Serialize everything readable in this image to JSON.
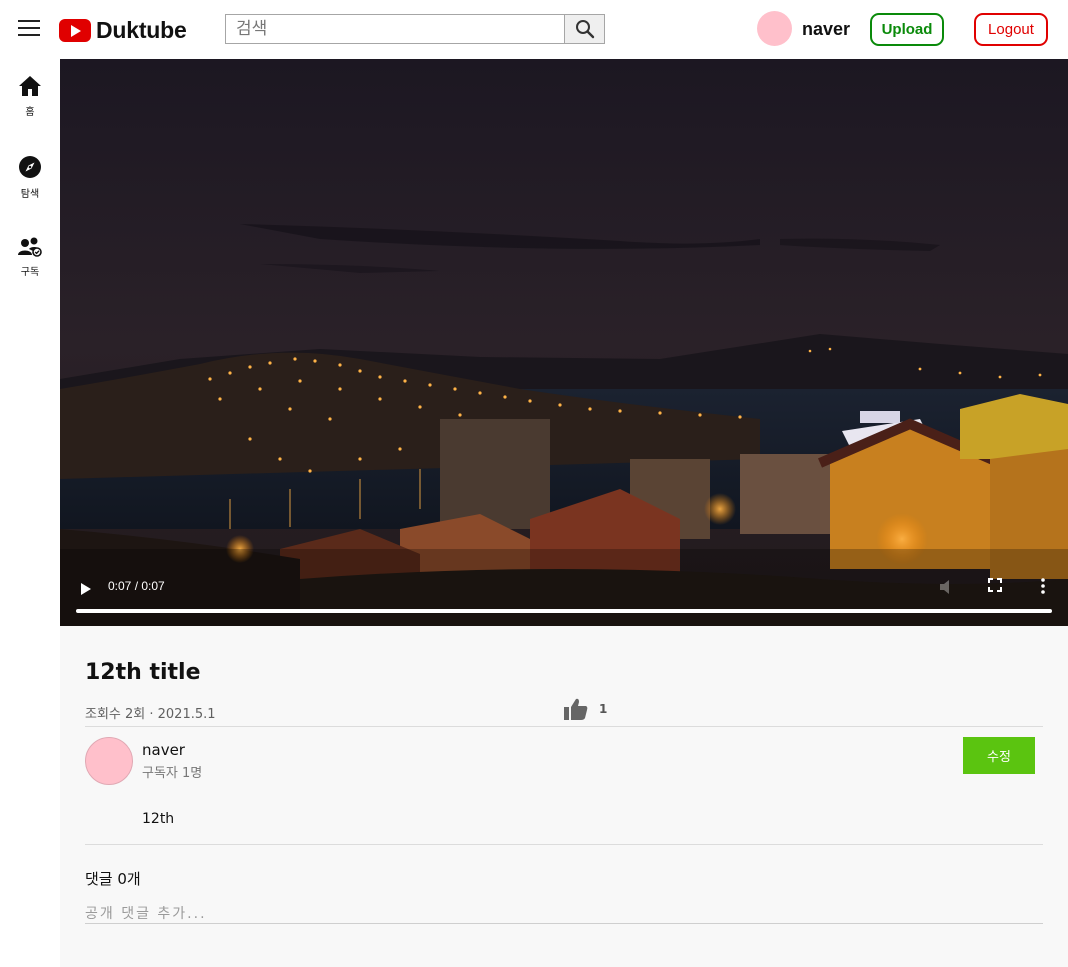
{
  "header": {
    "logo_text": "Duktube",
    "search_placeholder": "검색",
    "username": "naver",
    "upload_label": "Upload",
    "logout_label": "Logout",
    "avatar_color": "#ffc0cb"
  },
  "sidebar": {
    "items": [
      {
        "label": "홈",
        "icon": "home-icon"
      },
      {
        "label": "탐색",
        "icon": "compass-icon"
      },
      {
        "label": "구독",
        "icon": "subscriptions-icon"
      }
    ]
  },
  "player": {
    "time": "0:07 / 0:07",
    "progress": 1.0
  },
  "video": {
    "title": "12th title",
    "meta": "조회수 2회 · 2021.5.1",
    "like_count": "1",
    "channel_name": "naver",
    "subscribers": "구독자 1명",
    "edit_label": "수정",
    "description": "12th"
  },
  "comments": {
    "count_label": "댓글 0개",
    "placeholder": "공개 댓글 추가..."
  },
  "colors": {
    "brand_red": "#e00000",
    "upload_green": "#0a8a0a",
    "edit_green": "#5bc410"
  }
}
